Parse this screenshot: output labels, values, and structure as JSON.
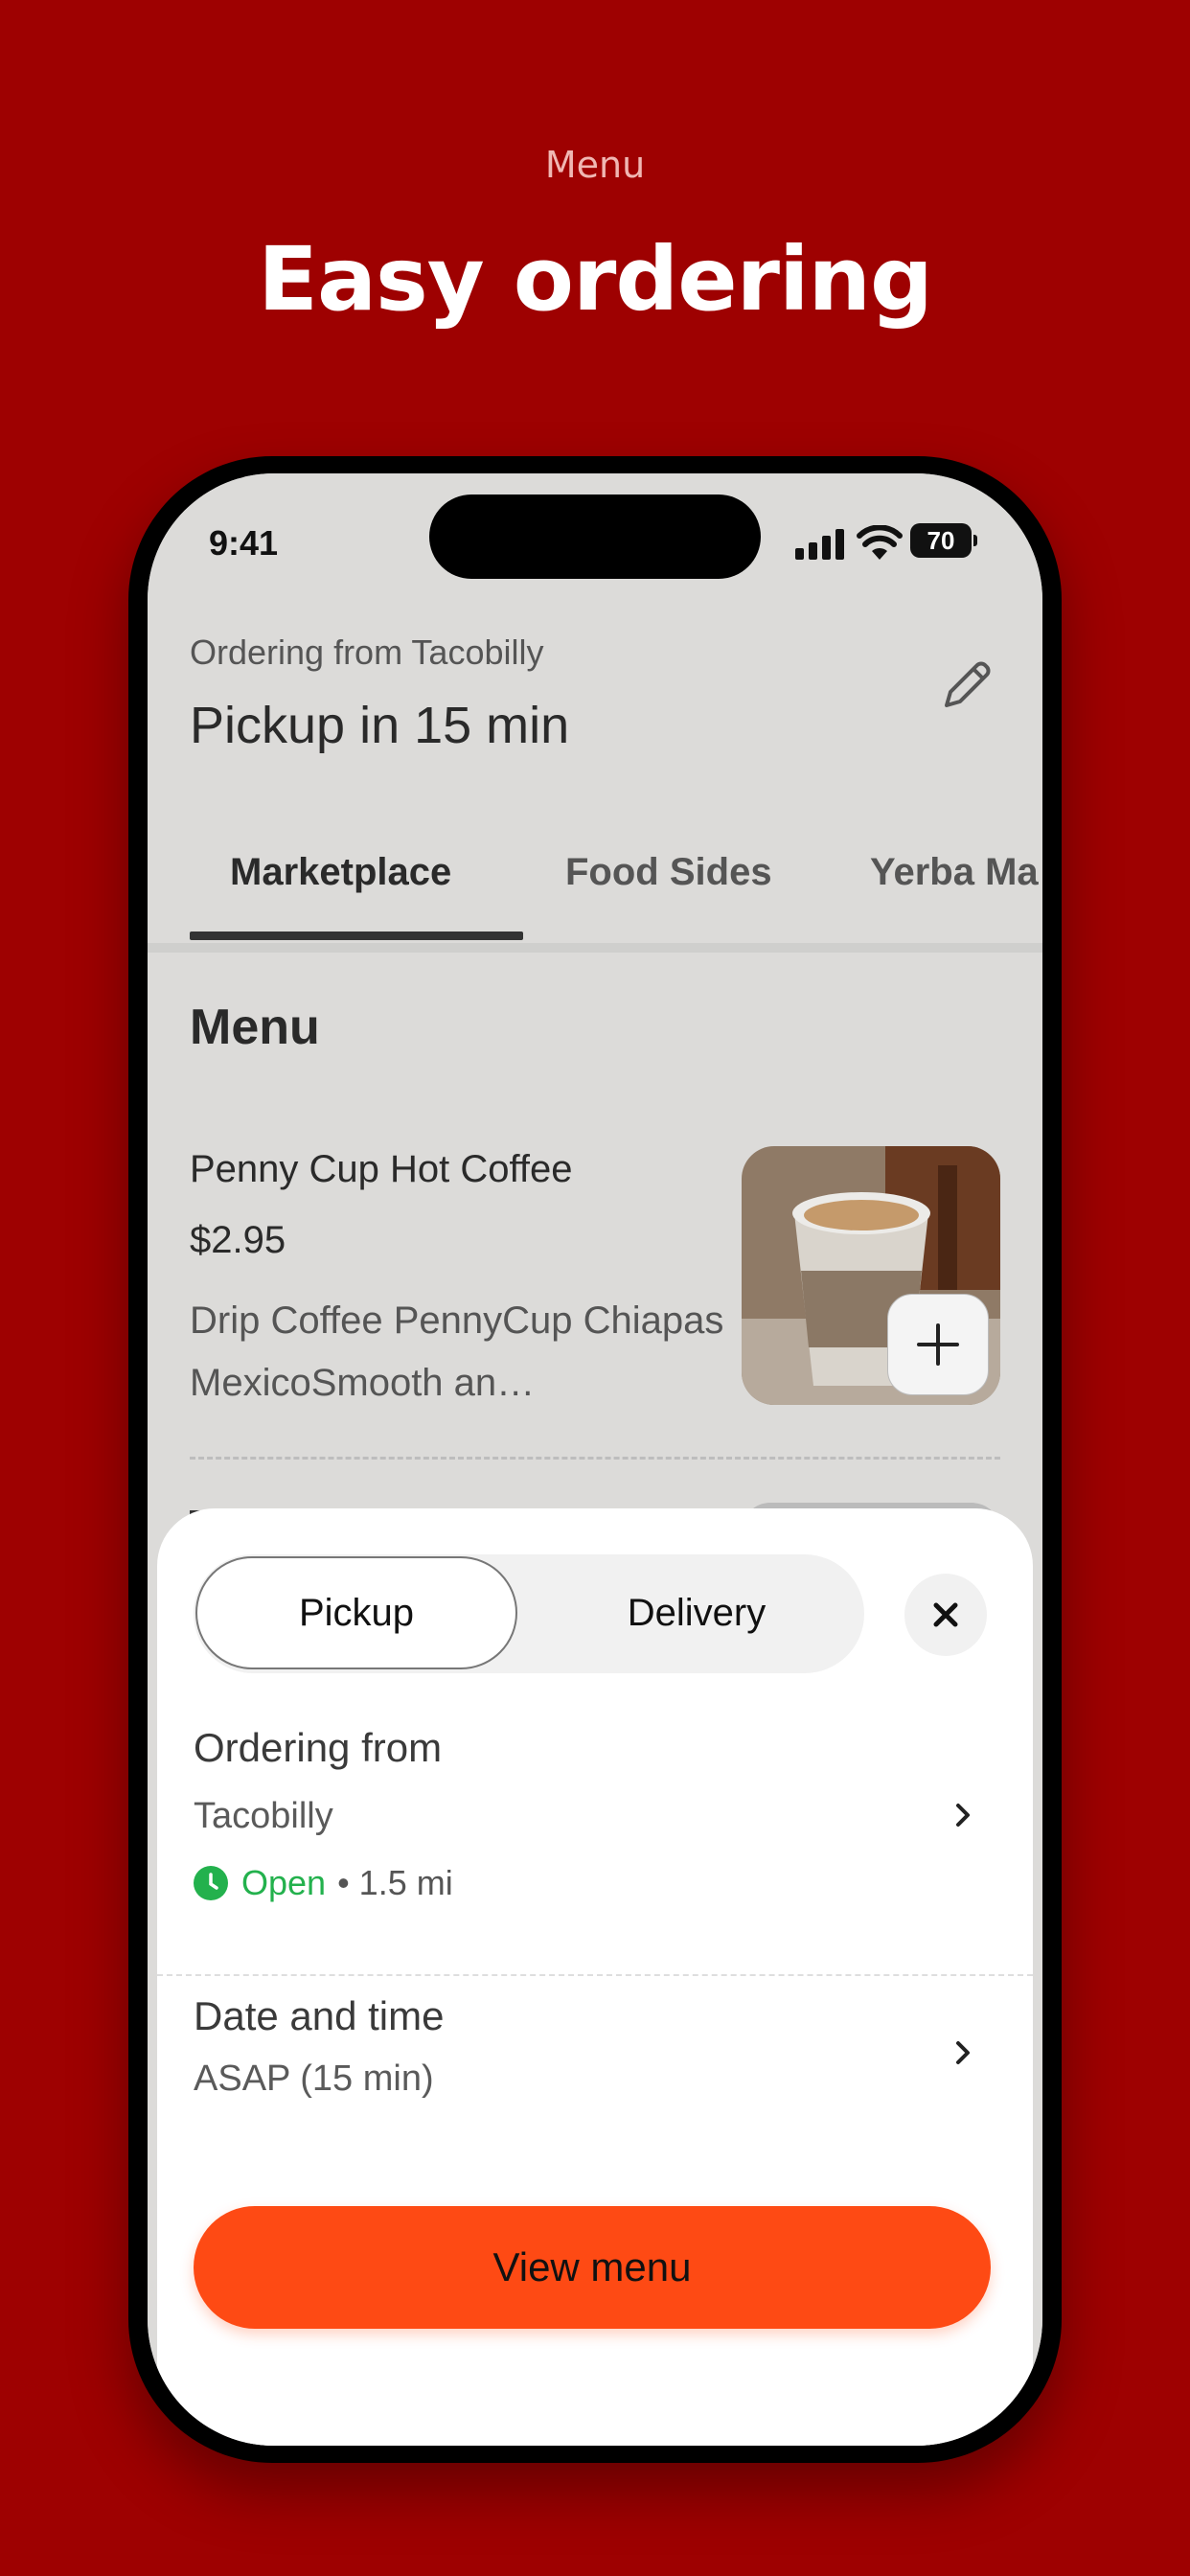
{
  "promo": {
    "eyebrow": "Menu",
    "headline": "Easy ordering"
  },
  "status_bar": {
    "time": "9:41",
    "battery": "70"
  },
  "header": {
    "ordering_from": "Ordering from Tacobilly",
    "pickup_time": "Pickup in 15 min",
    "edit_icon": "pencil-icon"
  },
  "tabs": [
    {
      "label": "Marketplace",
      "active": true
    },
    {
      "label": "Food Sides",
      "active": false
    },
    {
      "label": "Yerba Ma",
      "active": false
    }
  ],
  "menu": {
    "title": "Menu",
    "items": [
      {
        "name": "Penny Cup Hot Coffee",
        "price": "$2.95",
        "description": "Drip Coffee PennyCup Chiapas MexicoSmooth an…",
        "add_icon": "plus-icon"
      }
    ]
  },
  "sheet": {
    "mode_options": [
      "Pickup",
      "Delivery"
    ],
    "selected_mode": "Pickup",
    "close_icon": "close-icon",
    "location": {
      "label": "Ordering from",
      "value": "Tacobilly",
      "status": "Open",
      "distance": "• 1.5 mi"
    },
    "datetime": {
      "label": "Date and time",
      "value": "ASAP (15 min)"
    },
    "cta": "View menu"
  },
  "colors": {
    "background": "#9e0101",
    "accent": "#fe4a14",
    "open_green": "#23b14d"
  }
}
